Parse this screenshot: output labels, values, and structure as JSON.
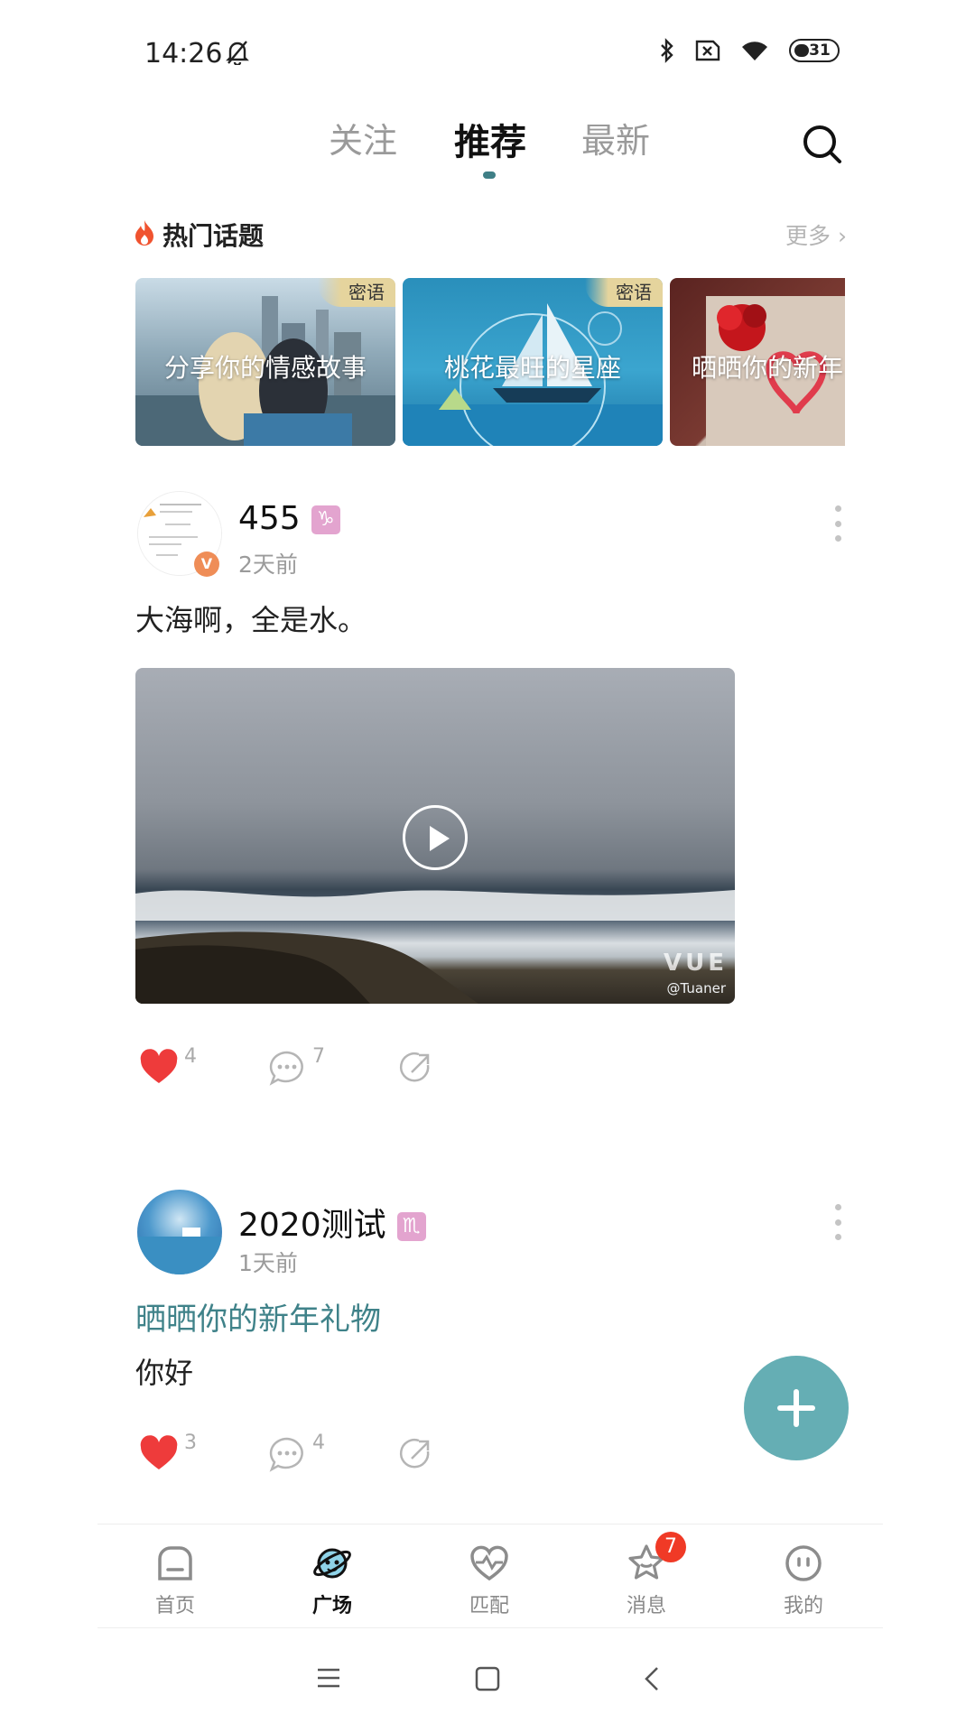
{
  "status_bar": {
    "time": "14:26",
    "battery": "31",
    "icons": [
      "bell-off-icon",
      "bluetooth-icon",
      "sim-off-icon",
      "wifi-icon",
      "battery-icon"
    ]
  },
  "top_tabs": [
    {
      "label": "关注",
      "active": false
    },
    {
      "label": "推荐",
      "active": true
    },
    {
      "label": "最新",
      "active": false
    }
  ],
  "hot_topics": {
    "title": "热门话题",
    "more_label": "更多",
    "cards": [
      {
        "text": "分享你的情感故事",
        "tag": "密语"
      },
      {
        "text": "桃花最旺的星座",
        "tag": "密语"
      },
      {
        "text": "晒晒你的新年"
      }
    ]
  },
  "posts": [
    {
      "username": "455",
      "zodiac_icon": "capricorn-icon",
      "time": "2天前",
      "text": "大海啊，全是水。",
      "video_watermark": "@Tuaner",
      "video_logo": "VUE",
      "likes": "4",
      "comments": "7",
      "liked": true
    },
    {
      "username": "2020测试",
      "zodiac_icon": "scorpio-icon",
      "time": "1天前",
      "topic": "晒晒你的新年礼物",
      "text": "你好",
      "likes": "3",
      "comments": "4",
      "liked": true
    }
  ],
  "bottom_nav": [
    {
      "label": "首页",
      "icon": "home-icon",
      "active": false
    },
    {
      "label": "广场",
      "icon": "planet-icon",
      "active": true
    },
    {
      "label": "匹配",
      "icon": "heart-pulse-icon",
      "active": false
    },
    {
      "label": "消息",
      "icon": "star-message-icon",
      "active": false,
      "badge": "7"
    },
    {
      "label": "我的",
      "icon": "face-icon",
      "active": false
    }
  ],
  "colors": {
    "accent": "#3f8289",
    "fab": "#65aeb4",
    "like": "#ee3b3b",
    "badge": "#f03a26"
  }
}
